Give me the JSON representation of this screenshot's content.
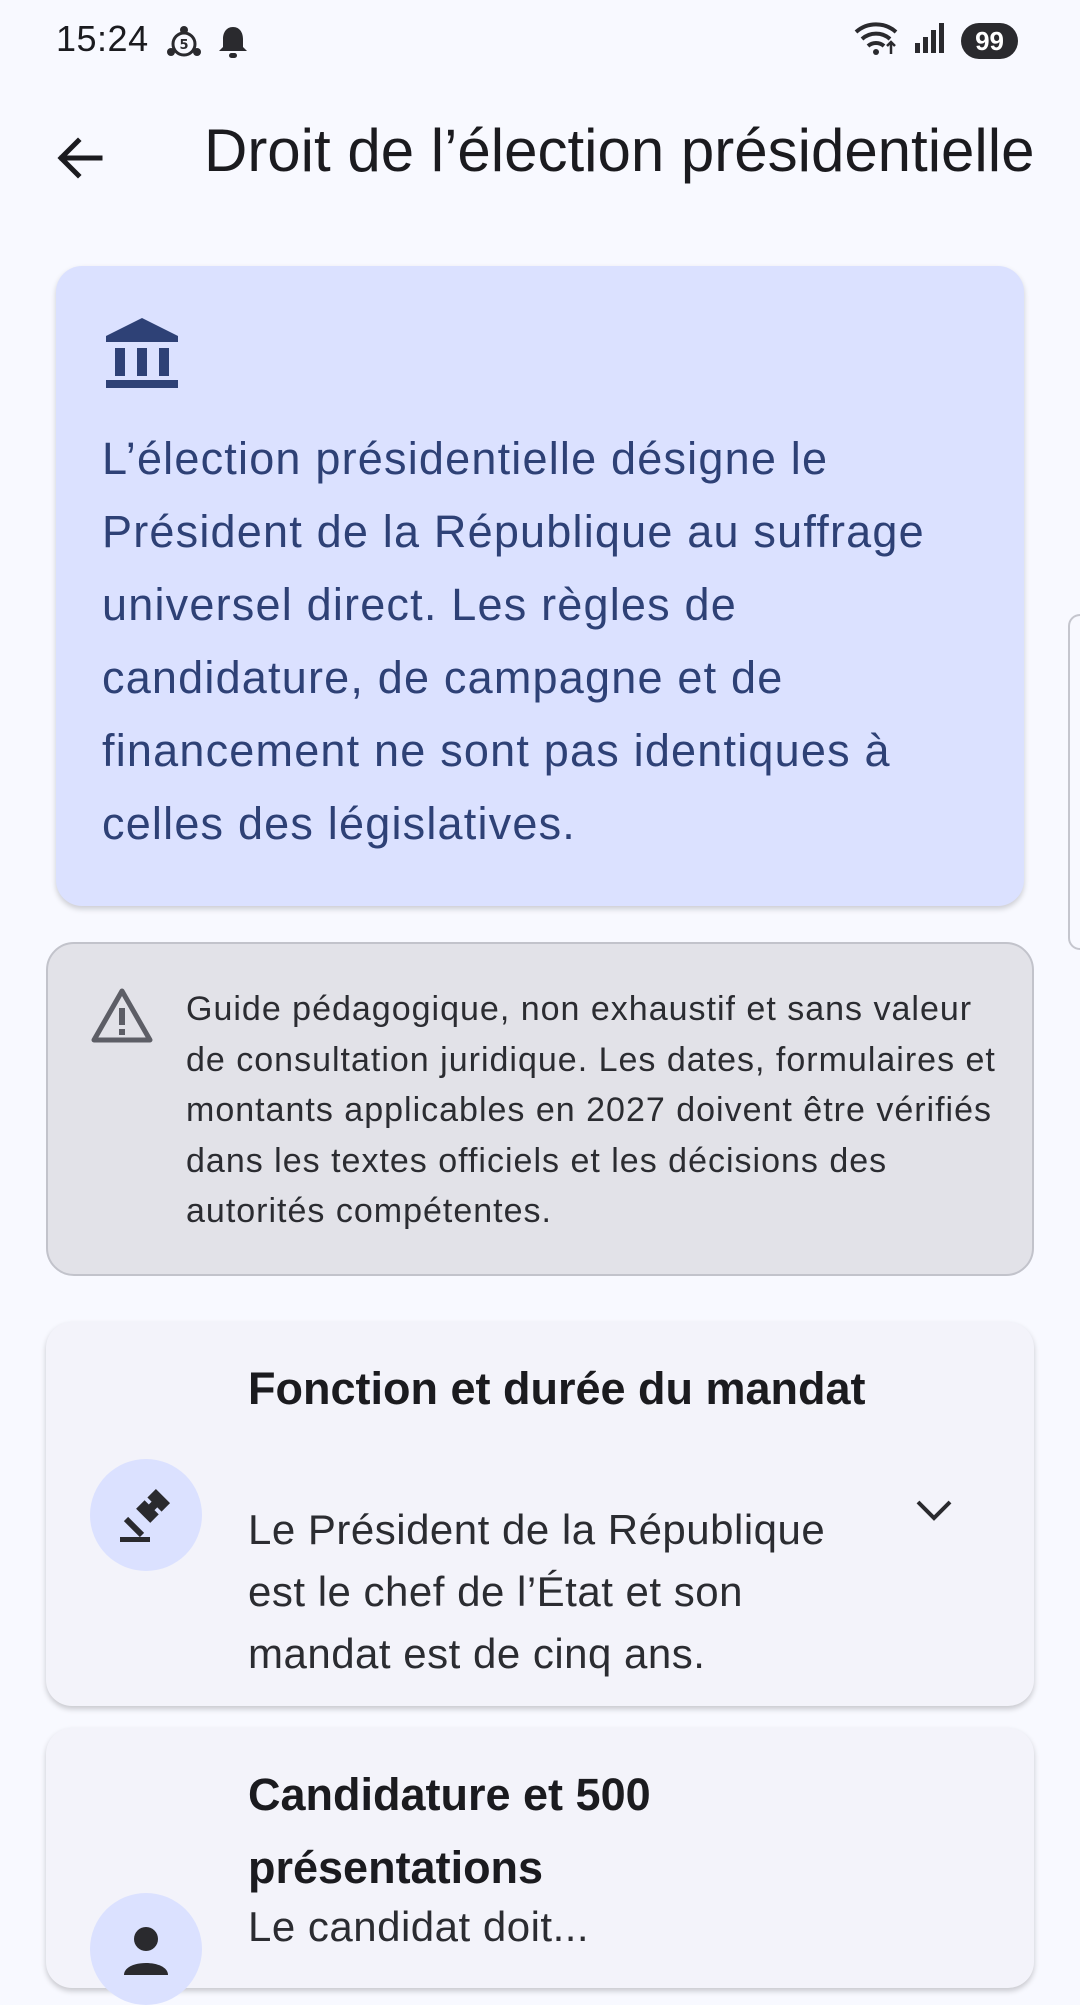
{
  "status_bar": {
    "time": "15:24",
    "battery": "99",
    "icons": [
      "sync-badge-icon",
      "bell-icon",
      "wifi-icon",
      "signal-icon"
    ]
  },
  "app_bar": {
    "title": "Droit de l’élection présidentielle",
    "back_icon": "arrow-left-icon"
  },
  "intro": {
    "icon": "bank-building-icon",
    "text": "L’élection présidentielle désigne le Président de la République au suffrage universel direct. Les règles de candidature, de campagne et de financement ne sont pas identiques à celles des législatives."
  },
  "disclaimer": {
    "icon": "warning-triangle-icon",
    "text": "Guide pédagogique, non exhaustif et sans valeur de consultation juridique. Les dates, formulaires et montants applicables en 2027 doivent être vérifiés dans les textes officiels et les décisions des autorités compétentes."
  },
  "sections": [
    {
      "icon": "gavel-icon",
      "title": "Fonction et durée du mandat",
      "summary": "Le Président de la République est le chef de l’État et son mandat est de cinq ans.",
      "expanded": false
    },
    {
      "icon": "person-icon",
      "title": "Candidature et 500 présentations",
      "summary": "Le candidat doit...",
      "expanded": false
    }
  ],
  "colors": {
    "background": "#f8f9ff",
    "intro_card": "#dbe1ff",
    "intro_text": "#2e4176",
    "disclaimer_bg": "#e2e2e8",
    "card_bg": "#f3f3fa"
  }
}
